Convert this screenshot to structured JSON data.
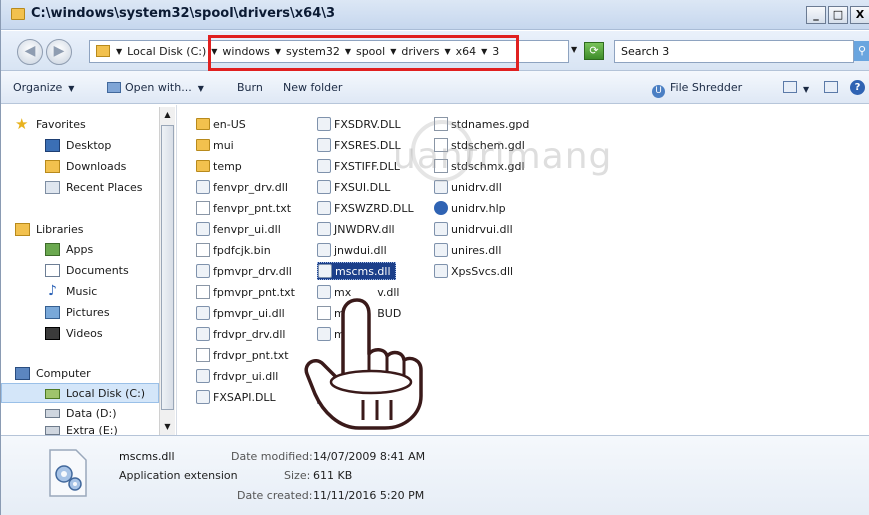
{
  "window": {
    "title": "C:\\windows\\system32\\spool\\drivers\\x64\\3",
    "min_symbol": "_",
    "max_symbol": "□",
    "close_symbol": "X"
  },
  "address": {
    "crumbs": [
      "Local Disk (C:)",
      "windows",
      "system32",
      "spool",
      "drivers",
      "x64",
      "3"
    ],
    "back_icon": "back-arrow-icon",
    "forward_icon": "forward-arrow-icon",
    "highlight_color": "#e02020"
  },
  "search": {
    "text": "Search 3"
  },
  "toolbar": {
    "organize": "Organize",
    "open_with": "Open with...",
    "burn": "Burn",
    "new_folder": "New folder",
    "file_shredder": "File Shredder"
  },
  "nav": {
    "favorites": "Favorites",
    "desktop": "Desktop",
    "downloads": "Downloads",
    "recent_places": "Recent Places",
    "libraries": "Libraries",
    "apps": "Apps",
    "documents": "Documents",
    "music": "Music",
    "pictures": "Pictures",
    "videos": "Videos",
    "computer": "Computer",
    "local_disk": "Local Disk (C:)",
    "data_d": "Data (D:)",
    "extra_e": "Extra (E:)"
  },
  "files": {
    "col1": [
      {
        "name": "en-US",
        "type": "folder"
      },
      {
        "name": "mui",
        "type": "folder"
      },
      {
        "name": "temp",
        "type": "folder"
      },
      {
        "name": "fenvpr_drv.dll",
        "type": "dll"
      },
      {
        "name": "fenvpr_pnt.txt",
        "type": "txt"
      },
      {
        "name": "fenvpr_ui.dll",
        "type": "dll"
      },
      {
        "name": "fpdfcjk.bin",
        "type": "txt"
      },
      {
        "name": "fpmvpr_drv.dll",
        "type": "dll"
      },
      {
        "name": "fpmvpr_pnt.txt",
        "type": "txt"
      },
      {
        "name": "fpmvpr_ui.dll",
        "type": "dll"
      },
      {
        "name": "frdvpr_drv.dll",
        "type": "dll"
      },
      {
        "name": "frdvpr_pnt.txt",
        "type": "txt"
      },
      {
        "name": "frdvpr_ui.dll",
        "type": "dll"
      },
      {
        "name": "FXSAPI.DLL",
        "type": "dll"
      }
    ],
    "col2": [
      {
        "name": "FXSDRV.DLL",
        "type": "dll"
      },
      {
        "name": "FXSRES.DLL",
        "type": "dll"
      },
      {
        "name": "FXSTIFF.DLL",
        "type": "dll"
      },
      {
        "name": "FXSUI.DLL",
        "type": "dll"
      },
      {
        "name": "FXSWZRD.DLL",
        "type": "dll"
      },
      {
        "name": "JNWDRV.dll",
        "type": "dll"
      },
      {
        "name": "jnwdui.dll",
        "type": "dll"
      },
      {
        "name": "mscms.dll",
        "type": "dll",
        "selected": true
      },
      {
        "name": "mx",
        "tail": "v.dll",
        "type": "dll"
      },
      {
        "name": "mx",
        "tail": "BUD",
        "type": "txt"
      },
      {
        "name": "mx",
        "type": "dll"
      },
      {
        "name": "",
        "type": "blank"
      },
      {
        "name": "",
        "type": "dll"
      },
      {
        "name": "std",
        "type": "txt"
      }
    ],
    "col3": [
      {
        "name": "stdnames.gpd",
        "type": "txt"
      },
      {
        "name": "stdschem.gdl",
        "type": "txt"
      },
      {
        "name": "stdschmx.gdl",
        "type": "txt"
      },
      {
        "name": "unidrv.dll",
        "type": "dll"
      },
      {
        "name": "unidrv.hlp",
        "type": "hlp"
      },
      {
        "name": "unidrvui.dll",
        "type": "dll"
      },
      {
        "name": "unires.dll",
        "type": "dll"
      },
      {
        "name": "XpsSvcs.dll",
        "type": "dll"
      }
    ]
  },
  "watermark": {
    "text": "uantrimang"
  },
  "details": {
    "name": "mscms.dll",
    "type": "Application extension",
    "date_modified_label": "Date modified:",
    "date_modified": "14/07/2009 8:41 AM",
    "size_label": "Size:",
    "size": "611 KB",
    "date_created_label": "Date created:",
    "date_created": "11/11/2016 5:20 PM"
  }
}
